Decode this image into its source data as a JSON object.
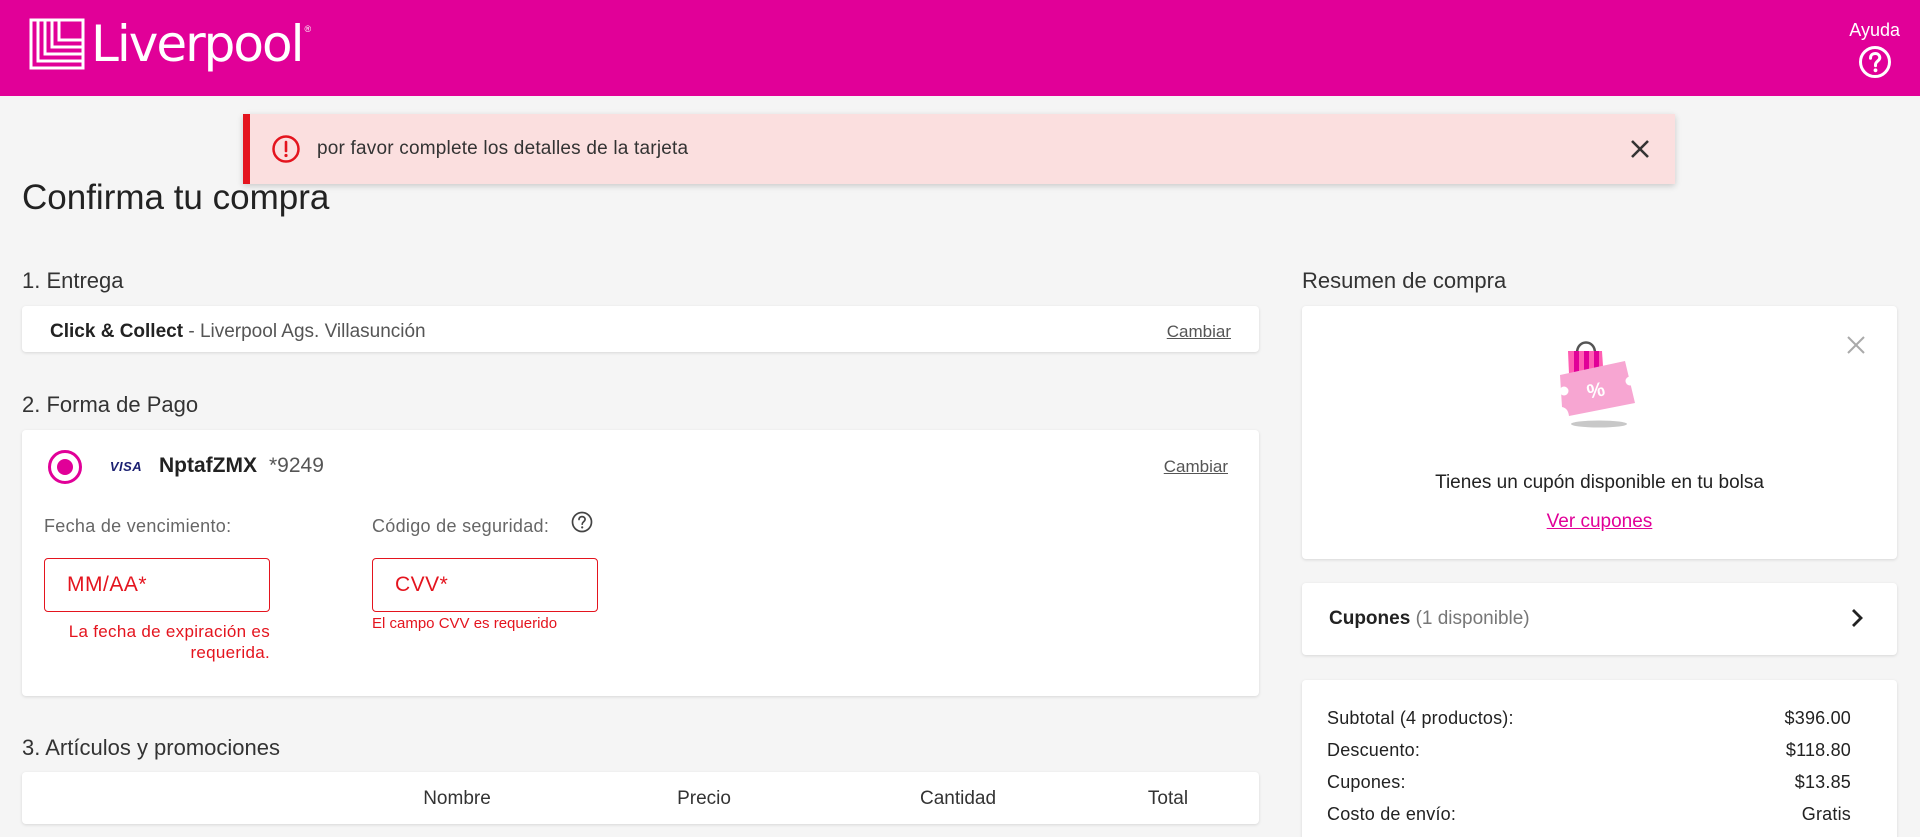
{
  "header": {
    "logo_text": "Liverpool",
    "logo_reg": "®",
    "help_label": "Ayuda",
    "bg_color": "#e10098"
  },
  "alert": {
    "message": "por favor complete los detalles de la tarjeta",
    "icon": "alert-circle-icon",
    "close_icon": "close-icon"
  },
  "page_title": "Confirma tu compra",
  "delivery": {
    "title": "1. Entrega",
    "method": "Click & Collect",
    "separator": " - ",
    "store": "Liverpool Ags. Villasunción",
    "change_label": "Cambiar"
  },
  "payment": {
    "title": "2. Forma de Pago",
    "card_brand": "VISA",
    "card_name": "NptafZMX",
    "card_number": "*9249",
    "change_label": "Cambiar",
    "expiry_label": "Fecha de vencimiento:",
    "expiry_placeholder": "MM/AA*",
    "expiry_error": "La fecha de expiración es requerida.",
    "cvv_label": "Código de seguridad:",
    "cvv_placeholder": "CVV*",
    "cvv_error": "El campo CVV es requerido"
  },
  "items": {
    "title": "3. Artículos y promociones",
    "columns": [
      "Nombre",
      "Precio",
      "Cantidad",
      "Total"
    ]
  },
  "summary": {
    "title": "Resumen de compra",
    "coupon_message": "Tienes un cupón disponible en tu bolsa",
    "coupon_link": "Ver cupones",
    "coupons_label": "Cupones",
    "coupons_count": "(1 disponible)",
    "rows": [
      {
        "label": "Subtotal (4 productos):",
        "value": "$396.00"
      },
      {
        "label": "Descuento:",
        "value": "$118.80"
      },
      {
        "label": "Cupones:",
        "value": "$13.85"
      },
      {
        "label": "Costo de envío:",
        "value": "Gratis"
      }
    ]
  },
  "colors": {
    "brand": "#e10098",
    "error": "#e4141e",
    "alert_bg": "#fbdfdf"
  }
}
